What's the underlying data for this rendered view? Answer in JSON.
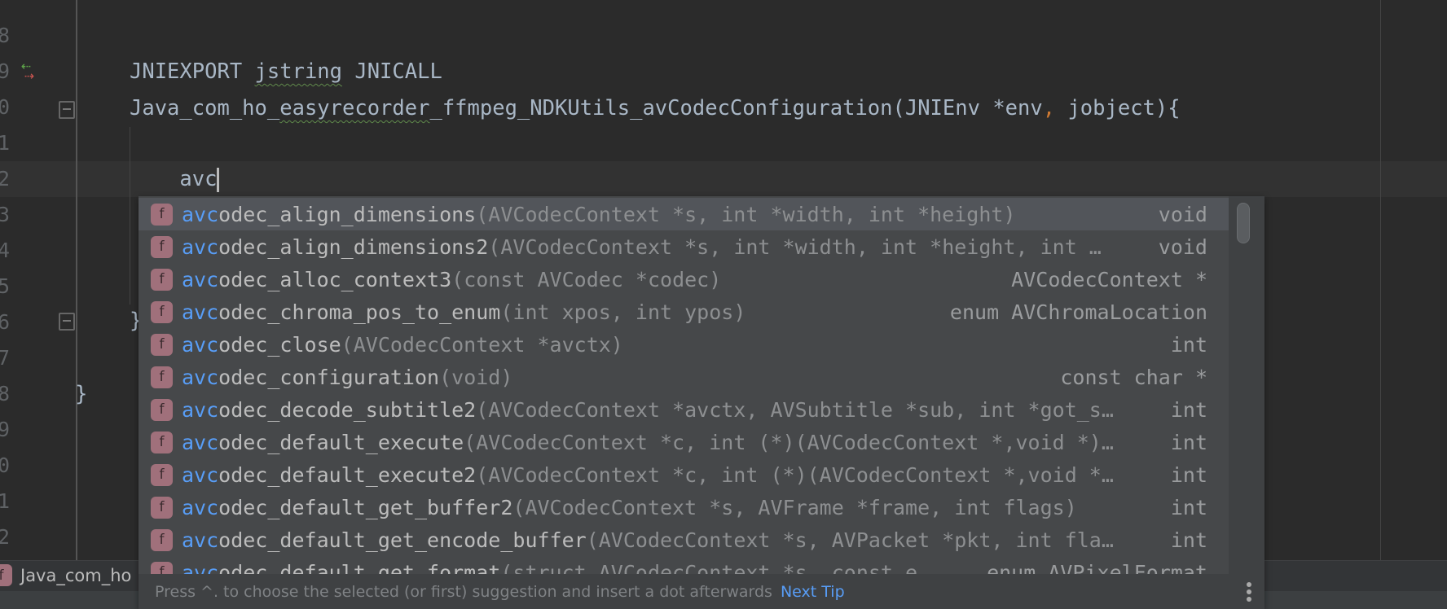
{
  "editor": {
    "line_numbers": [
      "8",
      "9",
      "0",
      "1",
      "2",
      "3",
      "4",
      "5",
      "6",
      "7",
      "8",
      "9",
      "0",
      "1",
      "2"
    ],
    "lines": {
      "l1_a": "JNIEXPORT ",
      "l1_b": "jstring",
      "l1_c": " JNICALL",
      "l2_a": "Java_com_ho_",
      "l2_b": "easyrecorder",
      "l2_c": "_ffmpeg_NDKUtils_avCodecConfiguration(JNIEnv *env",
      "l2_comma": ",",
      "l2_d": " jobject){",
      "l3": "    avc",
      "close_inner": "}",
      "close_outer": "}"
    }
  },
  "completion": {
    "typed": "avc",
    "items": [
      {
        "rest": "odec_align_dimensions",
        "params": "(AVCodecContext *s, int *width, int *height)",
        "ret": "void",
        "selected": true
      },
      {
        "rest": "odec_align_dimensions2",
        "params": "(AVCodecContext *s, int *width, int *height, int …",
        "ret": "void"
      },
      {
        "rest": "odec_alloc_context3",
        "params": "(const AVCodec *codec)",
        "ret": "AVCodecContext *"
      },
      {
        "rest": "odec_chroma_pos_to_enum",
        "params": "(int xpos, int ypos)",
        "ret": "enum AVChromaLocation"
      },
      {
        "rest": "odec_close",
        "params": "(AVCodecContext *avctx)",
        "ret": "int"
      },
      {
        "rest": "odec_configuration",
        "params": "(void)",
        "ret": "const char *"
      },
      {
        "rest": "odec_decode_subtitle2",
        "params": "(AVCodecContext *avctx, AVSubtitle *sub, int *got_s…",
        "ret": "int"
      },
      {
        "rest": "odec_default_execute",
        "params": "(AVCodecContext *c, int (*)(AVCodecContext *,void *)…",
        "ret": "int"
      },
      {
        "rest": "odec_default_execute2",
        "params": "(AVCodecContext *c, int (*)(AVCodecContext *,void *…",
        "ret": "int"
      },
      {
        "rest": "odec_default_get_buffer2",
        "params": "(AVCodecContext *s, AVFrame *frame, int flags)",
        "ret": "int"
      },
      {
        "rest": "odec_default_get_encode_buffer",
        "params": "(AVCodecContext *s, AVPacket *pkt, int fla…",
        "ret": "int"
      },
      {
        "rest": "odec_default_get_format",
        "params": "(struct AVCodecContext *s, const e…",
        "ret": "enum AVPixelFormat"
      }
    ],
    "item_icon": "f",
    "footer_hint": "Press ^. to choose the selected (or first) suggestion and insert a dot afterwards",
    "next_tip": "Next Tip"
  },
  "breadcrumb": {
    "icon": "f",
    "label": "Java_com_ho"
  },
  "colors": {
    "accent": "#589df6",
    "keyword_comma": "#cc7832",
    "function_badge": "#a0707b"
  }
}
